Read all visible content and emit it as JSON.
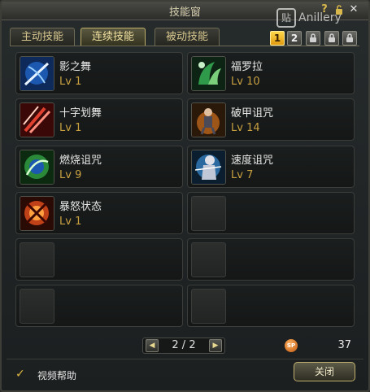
{
  "window": {
    "title": "技能窗",
    "watermark_text": "Anillery",
    "watermark_logo": "贴"
  },
  "titlebar_buttons": {
    "help": "?",
    "close": "✕"
  },
  "tabs": [
    {
      "label": "主动技能",
      "active": false
    },
    {
      "label": "连续技能",
      "active": true
    },
    {
      "label": "被动技能",
      "active": false
    }
  ],
  "pages": [
    {
      "label": "1",
      "active": true,
      "locked": false
    },
    {
      "label": "2",
      "active": false,
      "locked": false
    },
    {
      "label": "",
      "active": false,
      "locked": true
    },
    {
      "label": "",
      "active": false,
      "locked": true
    },
    {
      "label": "",
      "active": false,
      "locked": true
    }
  ],
  "skills": [
    {
      "name": "影之舞",
      "level": "Lv 1",
      "icon": "shadow-dance-icon",
      "color": "#3a7ad0"
    },
    {
      "name": "福罗拉",
      "level": "Lv 10",
      "icon": "flora-icon",
      "color": "#2f9a4a"
    },
    {
      "name": "十字划舞",
      "level": "Lv 1",
      "icon": "cross-slash-icon",
      "color": "#c0302a"
    },
    {
      "name": "破甲诅咒",
      "level": "Lv 14",
      "icon": "armor-break-curse-icon",
      "color": "#d07020"
    },
    {
      "name": "燃烧诅咒",
      "level": "Lv 9",
      "icon": "burning-curse-icon",
      "color": "#40b040"
    },
    {
      "name": "速度诅咒",
      "level": "Lv 7",
      "icon": "speed-curse-icon",
      "color": "#2a6aa0"
    },
    {
      "name": "暴怒状态",
      "level": "Lv 1",
      "icon": "rage-state-icon",
      "color": "#c04018"
    },
    {
      "name": "",
      "level": "",
      "icon": "",
      "color": ""
    },
    {
      "name": "",
      "level": "",
      "icon": "",
      "color": ""
    },
    {
      "name": "",
      "level": "",
      "icon": "",
      "color": ""
    },
    {
      "name": "",
      "level": "",
      "icon": "",
      "color": ""
    },
    {
      "name": "",
      "level": "",
      "icon": "",
      "color": ""
    }
  ],
  "pager": {
    "text": "2 / 2",
    "prev": "◀",
    "next": "▶"
  },
  "sp": {
    "icon_label": "SP",
    "value": "37"
  },
  "footer": {
    "checkbox_checked": true,
    "checkbox_mark": "✓",
    "checkbox_label": "视频帮助",
    "close_button": "关闭"
  },
  "colors": {
    "accent_gold": "#e0b840",
    "level_text": "#c8a040"
  }
}
